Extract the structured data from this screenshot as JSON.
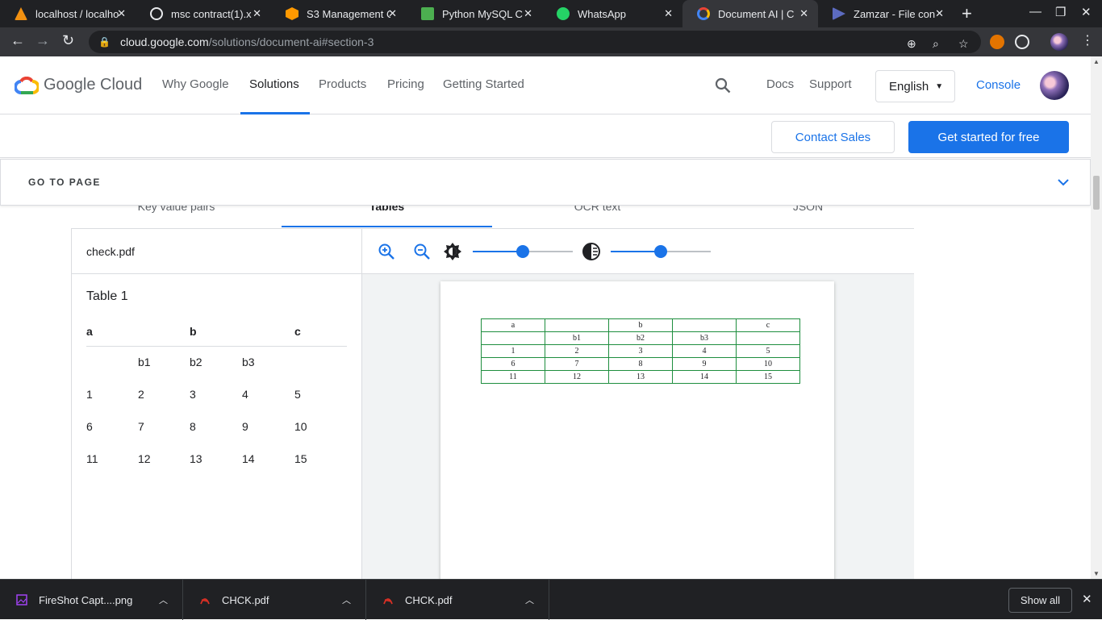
{
  "browser": {
    "tabs": [
      {
        "title": "localhost / localho",
        "icon": "phpmyadmin-icon",
        "color": "#f29111"
      },
      {
        "title": "msc contract(1).x",
        "icon": "globe-icon",
        "color": "#e8eaed"
      },
      {
        "title": "S3 Management C",
        "icon": "aws-icon",
        "color": "#ff9900"
      },
      {
        "title": "Python MySQL C",
        "icon": "w3schools-icon",
        "color": "#4caf50"
      },
      {
        "title": "WhatsApp",
        "icon": "whatsapp-icon",
        "color": "#25d366"
      },
      {
        "title": "Document AI  |  C",
        "icon": "google-cloud-icon",
        "color": "#4285f4"
      },
      {
        "title": "Zamzar - File con",
        "icon": "zamzar-icon",
        "color": "#5c6bc0"
      }
    ],
    "url_host": "cloud.google.com",
    "url_path": "/solutions/document-ai#section-3"
  },
  "header": {
    "logo_text": "Google Cloud",
    "nav": [
      "Why Google",
      "Solutions",
      "Products",
      "Pricing",
      "Getting Started"
    ],
    "active_nav": "Solutions",
    "docs": "Docs",
    "support": "Support",
    "language": "English",
    "console": "Console"
  },
  "cta": {
    "contact": "Contact Sales",
    "start": "Get started for free"
  },
  "goto": {
    "label": "GO TO PAGE"
  },
  "demo": {
    "tabs": [
      "Key value pairs",
      "Tables",
      "OCR text",
      "JSON"
    ],
    "active_tab": "Tables",
    "filename": "check.pdf",
    "table_title": "Table 1",
    "headers": [
      "a",
      "",
      "b",
      "",
      "c"
    ],
    "rows": [
      [
        "",
        "b1",
        "b2",
        "b3",
        ""
      ],
      [
        "1",
        "2",
        "3",
        "4",
        "5"
      ],
      [
        "6",
        "7",
        "8",
        "9",
        "10"
      ],
      [
        "11",
        "12",
        "13",
        "14",
        "15"
      ]
    ],
    "brightness_level": 0.5,
    "contrast_level": 0.5
  },
  "pdf_table": [
    [
      "a",
      "",
      "b",
      "",
      "c"
    ],
    [
      "",
      "b1",
      "b2",
      "b3",
      ""
    ],
    [
      "1",
      "2",
      "3",
      "4",
      "5"
    ],
    [
      "6",
      "7",
      "8",
      "9",
      "10"
    ],
    [
      "11",
      "12",
      "13",
      "14",
      "15"
    ]
  ],
  "downloads": [
    {
      "name": "FireShot Capt....png",
      "icon": "image-file-icon"
    },
    {
      "name": "CHCK.pdf",
      "icon": "pdf-file-icon"
    },
    {
      "name": "CHCK.pdf",
      "icon": "pdf-file-icon"
    }
  ],
  "show_all": "Show all",
  "colors": {
    "accent": "#1a73e8",
    "table_border": "#1e8e3e"
  }
}
